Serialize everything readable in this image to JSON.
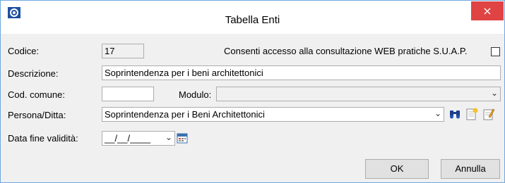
{
  "window": {
    "title": "Tabella Enti",
    "close_label": "×"
  },
  "form": {
    "codice_label": "Codice:",
    "codice_value": "17",
    "web_access_label": "Consenti accesso alla consultazione WEB pratiche S.U.A.P.",
    "web_access_checked": false,
    "descrizione_label": "Descrizione:",
    "descrizione_value": "Soprintendenza per i beni architettonici",
    "cod_comune_label": "Cod. comune:",
    "cod_comune_value": "",
    "modulo_label": "Modulo:",
    "modulo_value": "",
    "persona_label": "Persona/Ditta:",
    "persona_value": "Soprintendenza per i Beni Architettonici",
    "data_fine_label": "Data fine validità:",
    "data_fine_value": "__/__/____"
  },
  "buttons": {
    "ok": "OK",
    "annulla": "Annulla"
  },
  "icons": {
    "app": "app-icon",
    "search": "binoculars-search-icon",
    "new": "new-document-icon",
    "edit": "edit-document-icon",
    "calendar": "calendar-icon"
  },
  "colors": {
    "close": "#e04343",
    "border": "#6fa8dc"
  }
}
